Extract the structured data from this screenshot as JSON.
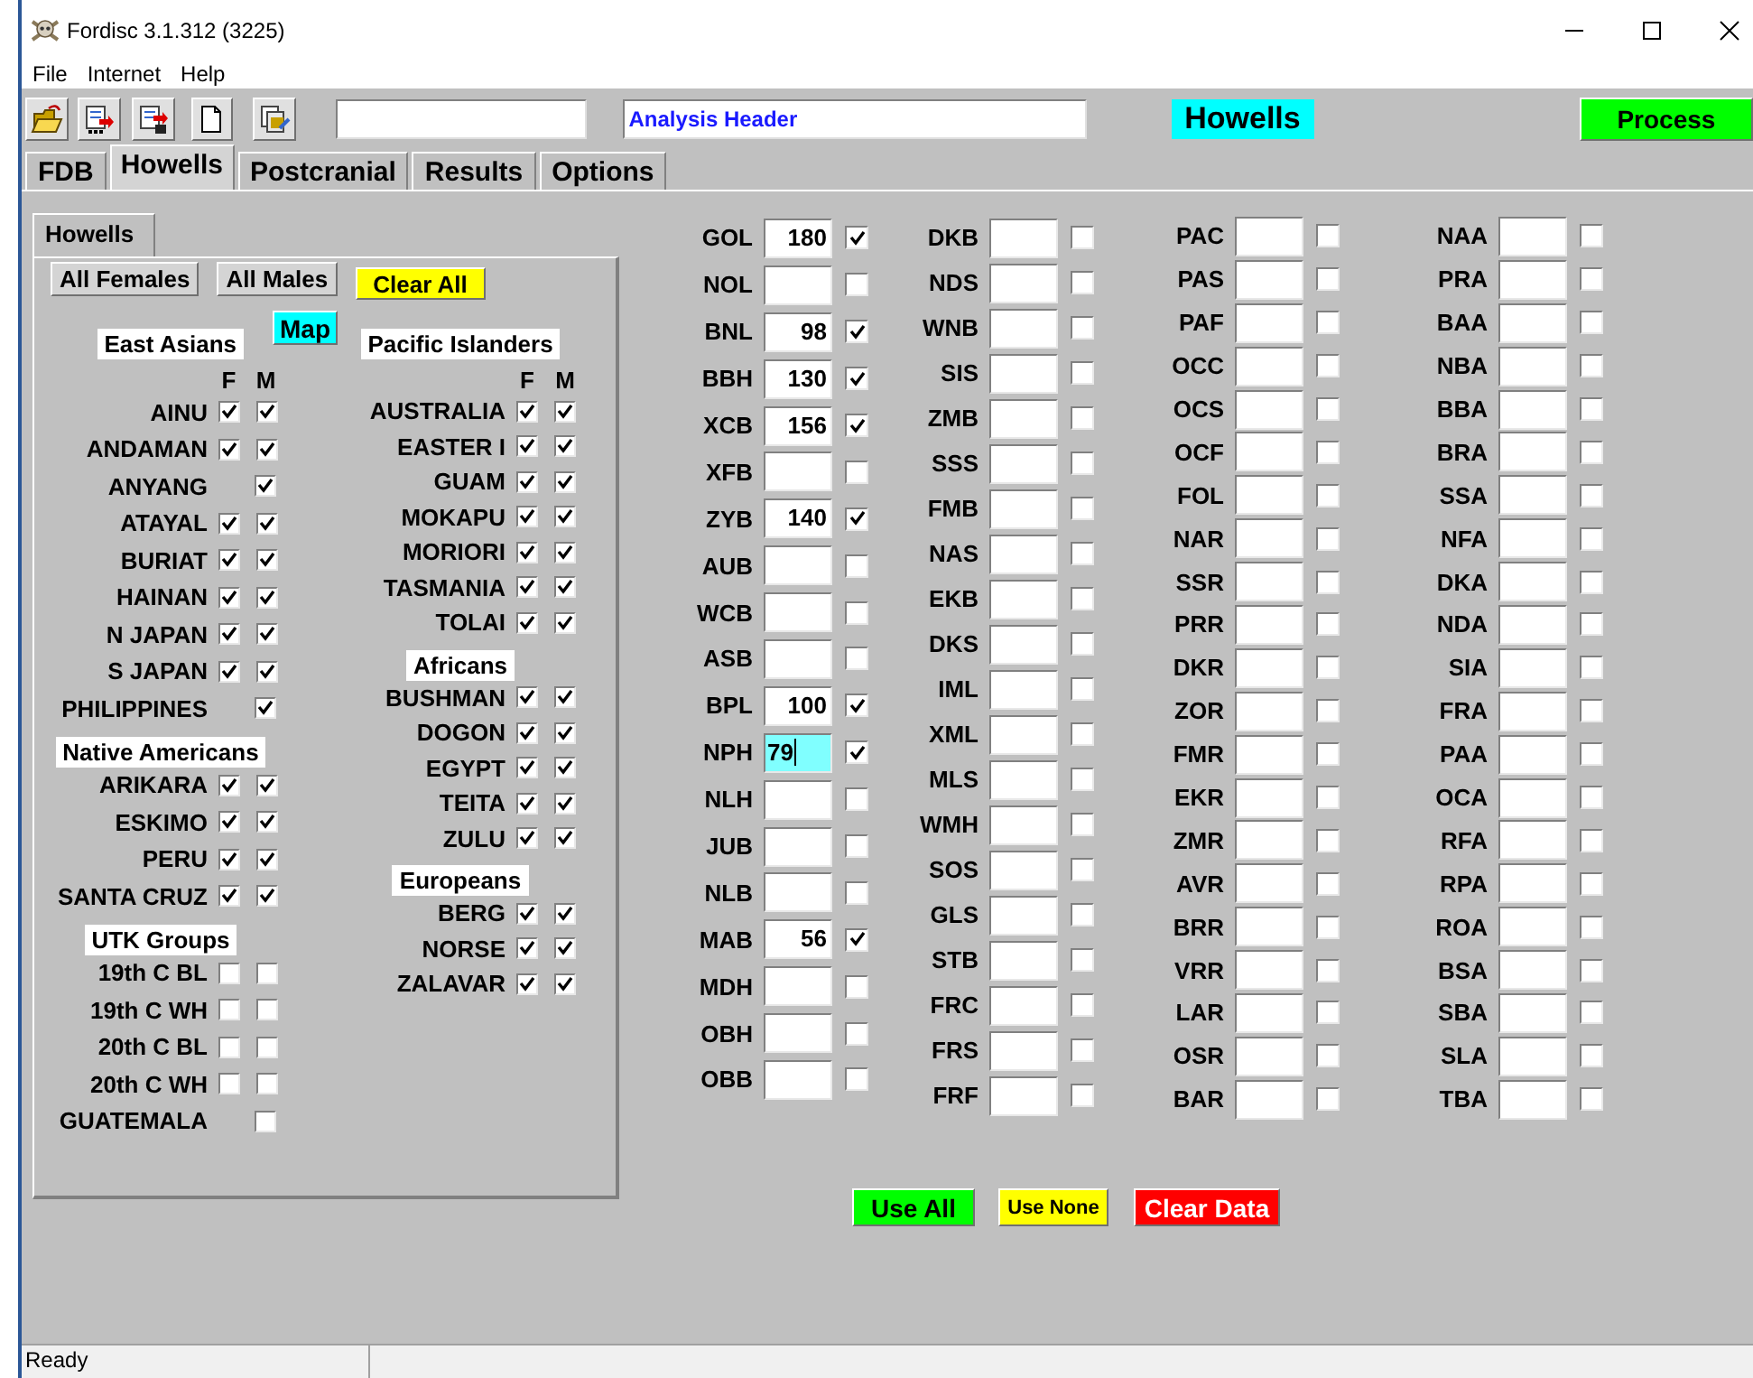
{
  "window": {
    "title": "Fordisc 3.1.312 (3225)"
  },
  "menu": [
    "File",
    "Internet",
    "Help"
  ],
  "analysis_header": "Analysis Header",
  "current_test": "Howells",
  "process_button": "Process",
  "tabs": [
    {
      "label": "FDB",
      "selected": false
    },
    {
      "label": "Howells",
      "selected": true
    },
    {
      "label": "Postcranial",
      "selected": false
    },
    {
      "label": "Results",
      "selected": false
    },
    {
      "label": "Options",
      "selected": false
    }
  ],
  "panel": {
    "tab": "Howells",
    "map_button": "Map",
    "buttons": [
      {
        "label": "All Females",
        "kind": "plain"
      },
      {
        "label": "All Males",
        "kind": "plain"
      },
      {
        "label": "Clear All",
        "kind": "clear"
      }
    ],
    "group_columns": [
      [
        {
          "name": "East Asians",
          "columns": [
            "F",
            "M"
          ],
          "populations": [
            {
              "name": "AINU",
              "female": true,
              "male": true
            },
            {
              "name": "ANDAMAN",
              "female": true,
              "male": true
            },
            {
              "name": "ANYANG",
              "male": true
            },
            {
              "name": "ATAYAL",
              "female": true,
              "male": true
            },
            {
              "name": "BURIAT",
              "female": true,
              "male": true
            },
            {
              "name": "HAINAN",
              "female": true,
              "male": true
            },
            {
              "name": "N JAPAN",
              "female": true,
              "male": true
            },
            {
              "name": "S JAPAN",
              "female": true,
              "male": true
            },
            {
              "name": "PHILIPPINES",
              "male": true
            }
          ]
        },
        {
          "name": "Native Americans",
          "populations": [
            {
              "name": "ARIKARA",
              "female": true,
              "male": true
            },
            {
              "name": "ESKIMO",
              "female": true,
              "male": true
            },
            {
              "name": "PERU",
              "female": true,
              "male": true
            },
            {
              "name": "SANTA CRUZ",
              "female": true,
              "male": true
            }
          ]
        },
        {
          "name": "UTK Groups",
          "populations": [
            {
              "name": "19th C BL",
              "female": false,
              "male": false
            },
            {
              "name": "19th C WH",
              "female": false,
              "male": false
            },
            {
              "name": "20th C BL",
              "female": false,
              "male": false
            },
            {
              "name": "20th C WH",
              "female": false,
              "male": false
            },
            {
              "name": "GUATEMALA",
              "male": false
            }
          ]
        }
      ],
      [
        {
          "name": "Pacific Islanders",
          "columns": [
            "F",
            "M"
          ],
          "populations": [
            {
              "name": "AUSTRALIA",
              "female": true,
              "male": true
            },
            {
              "name": "EASTER I",
              "female": true,
              "male": true
            },
            {
              "name": "GUAM",
              "female": true,
              "male": true
            },
            {
              "name": "MOKAPU",
              "female": true,
              "male": true
            },
            {
              "name": "MORIORI",
              "female": true,
              "male": true
            },
            {
              "name": "TASMANIA",
              "female": true,
              "male": true
            },
            {
              "name": "TOLAI",
              "female": true,
              "male": true
            }
          ]
        },
        {
          "name": "Africans",
          "populations": [
            {
              "name": "BUSHMAN",
              "female": true,
              "male": true
            },
            {
              "name": "DOGON",
              "female": true,
              "male": true
            },
            {
              "name": "EGYPT",
              "female": true,
              "male": true
            },
            {
              "name": "TEITA",
              "female": true,
              "male": true
            },
            {
              "name": "ZULU",
              "female": true,
              "male": true
            }
          ]
        },
        {
          "name": "Europeans",
          "populations": [
            {
              "name": "BERG",
              "female": true,
              "male": true
            },
            {
              "name": "NORSE",
              "female": true,
              "male": true
            },
            {
              "name": "ZALAVAR",
              "female": true,
              "male": true
            }
          ]
        }
      ]
    ]
  },
  "measurement_columns": [
    [
      {
        "label": "GOL",
        "value": "180",
        "checked": true,
        "focused": false
      },
      {
        "label": "NOL",
        "checked": false,
        "focused": false
      },
      {
        "label": "BNL",
        "value": "98",
        "checked": true,
        "focused": false
      },
      {
        "label": "BBH",
        "value": "130",
        "checked": true,
        "focused": false
      },
      {
        "label": "XCB",
        "value": "156",
        "checked": true,
        "focused": false
      },
      {
        "label": "XFB",
        "checked": false,
        "focused": false
      },
      {
        "label": "ZYB",
        "value": "140",
        "checked": true,
        "focused": false
      },
      {
        "label": "AUB",
        "checked": false,
        "focused": false
      },
      {
        "label": "WCB",
        "checked": false,
        "focused": false
      },
      {
        "label": "ASB",
        "checked": false,
        "focused": false
      },
      {
        "label": "BPL",
        "value": "100",
        "checked": true,
        "focused": false
      },
      {
        "label": "NPH",
        "value": "79",
        "checked": true,
        "focused": true
      },
      {
        "label": "NLH",
        "checked": false,
        "focused": false
      },
      {
        "label": "JUB",
        "checked": false,
        "focused": false
      },
      {
        "label": "NLB",
        "checked": false,
        "focused": false
      },
      {
        "label": "MAB",
        "value": "56",
        "checked": true,
        "focused": false
      },
      {
        "label": "MDH",
        "checked": false,
        "focused": false
      },
      {
        "label": "OBH",
        "checked": false,
        "focused": false
      },
      {
        "label": "OBB",
        "checked": false,
        "focused": false
      }
    ],
    [
      {
        "label": "DKB",
        "checked": false,
        "focused": false
      },
      {
        "label": "NDS",
        "checked": false,
        "focused": false
      },
      {
        "label": "WNB",
        "checked": false,
        "focused": false
      },
      {
        "label": "SIS",
        "checked": false,
        "focused": false
      },
      {
        "label": "ZMB",
        "checked": false,
        "focused": false
      },
      {
        "label": "SSS",
        "checked": false,
        "focused": false
      },
      {
        "label": "FMB",
        "checked": false,
        "focused": false
      },
      {
        "label": "NAS",
        "checked": false,
        "focused": false
      },
      {
        "label": "EKB",
        "checked": false,
        "focused": false
      },
      {
        "label": "DKS",
        "checked": false,
        "focused": false
      },
      {
        "label": "IML",
        "checked": false,
        "focused": false
      },
      {
        "label": "XML",
        "checked": false,
        "focused": false
      },
      {
        "label": "MLS",
        "checked": false,
        "focused": false
      },
      {
        "label": "WMH",
        "checked": false,
        "focused": false
      },
      {
        "label": "SOS",
        "checked": false,
        "focused": false
      },
      {
        "label": "GLS",
        "checked": false,
        "focused": false
      },
      {
        "label": "STB",
        "checked": false,
        "focused": false
      },
      {
        "label": "FRC",
        "checked": false,
        "focused": false
      },
      {
        "label": "FRS",
        "checked": false,
        "focused": false
      },
      {
        "label": "FRF",
        "checked": false,
        "focused": false
      }
    ],
    [
      {
        "label": "PAC",
        "checked": false,
        "focused": false
      },
      {
        "label": "PAS",
        "checked": false,
        "focused": false
      },
      {
        "label": "PAF",
        "checked": false,
        "focused": false
      },
      {
        "label": "OCC",
        "checked": false,
        "focused": false
      },
      {
        "label": "OCS",
        "checked": false,
        "focused": false
      },
      {
        "label": "OCF",
        "checked": false,
        "focused": false
      },
      {
        "label": "FOL",
        "checked": false,
        "focused": false
      },
      {
        "label": "NAR",
        "checked": false,
        "focused": false
      },
      {
        "label": "SSR",
        "checked": false,
        "focused": false
      },
      {
        "label": "PRR",
        "checked": false,
        "focused": false
      },
      {
        "label": "DKR",
        "checked": false,
        "focused": false
      },
      {
        "label": "ZOR",
        "checked": false,
        "focused": false
      },
      {
        "label": "FMR",
        "checked": false,
        "focused": false
      },
      {
        "label": "EKR",
        "checked": false,
        "focused": false
      },
      {
        "label": "ZMR",
        "checked": false,
        "focused": false
      },
      {
        "label": "AVR",
        "checked": false,
        "focused": false
      },
      {
        "label": "BRR",
        "checked": false,
        "focused": false
      },
      {
        "label": "VRR",
        "checked": false,
        "focused": false
      },
      {
        "label": "LAR",
        "checked": false,
        "focused": false
      },
      {
        "label": "OSR",
        "checked": false,
        "focused": false
      },
      {
        "label": "BAR",
        "checked": false,
        "focused": false
      }
    ],
    [
      {
        "label": "NAA",
        "checked": false,
        "focused": false
      },
      {
        "label": "PRA",
        "checked": false,
        "focused": false
      },
      {
        "label": "BAA",
        "checked": false,
        "focused": false
      },
      {
        "label": "NBA",
        "checked": false,
        "focused": false
      },
      {
        "label": "BBA",
        "checked": false,
        "focused": false
      },
      {
        "label": "BRA",
        "checked": false,
        "focused": false
      },
      {
        "label": "SSA",
        "checked": false,
        "focused": false
      },
      {
        "label": "NFA",
        "checked": false,
        "focused": false
      },
      {
        "label": "DKA",
        "checked": false,
        "focused": false
      },
      {
        "label": "NDA",
        "checked": false,
        "focused": false
      },
      {
        "label": "SIA",
        "checked": false,
        "focused": false
      },
      {
        "label": "FRA",
        "checked": false,
        "focused": false
      },
      {
        "label": "PAA",
        "checked": false,
        "focused": false
      },
      {
        "label": "OCA",
        "checked": false,
        "focused": false
      },
      {
        "label": "RFA",
        "checked": false,
        "focused": false
      },
      {
        "label": "RPA",
        "checked": false,
        "focused": false
      },
      {
        "label": "ROA",
        "checked": false,
        "focused": false
      },
      {
        "label": "BSA",
        "checked": false,
        "focused": false
      },
      {
        "label": "SBA",
        "checked": false,
        "focused": false
      },
      {
        "label": "SLA",
        "checked": false,
        "focused": false
      },
      {
        "label": "TBA",
        "checked": false,
        "focused": false
      }
    ]
  ],
  "action_buttons": [
    {
      "label": "Use All",
      "kind": "use_all"
    },
    {
      "label": "Use None",
      "kind": "use_none"
    },
    {
      "label": "Clear Data",
      "kind": "clear"
    }
  ],
  "status_bar": [
    "Ready"
  ]
}
